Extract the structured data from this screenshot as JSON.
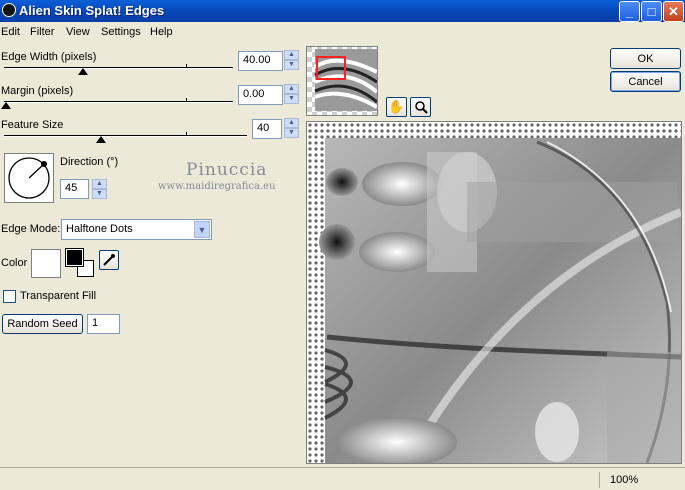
{
  "window": {
    "title": "Alien Skin Splat! Edges"
  },
  "menu": [
    "Edit",
    "Filter",
    "View",
    "Settings",
    "Help"
  ],
  "controls": {
    "edge_width": {
      "label": "Edge Width (pixels)",
      "value": "40.00"
    },
    "margin": {
      "label": "Margin (pixels)",
      "value": "0.00"
    },
    "feature_size": {
      "label": "Feature Size",
      "value": "40"
    },
    "direction": {
      "label": "Direction (°)",
      "value": "45"
    },
    "edge_mode": {
      "label": "Edge Mode:",
      "value": "Halftone Dots"
    },
    "color": {
      "label": "Color"
    },
    "transparent_fill": {
      "label": "Transparent Fill",
      "checked": false
    },
    "random_seed": {
      "button": "Random Seed",
      "value": "1"
    }
  },
  "buttons": {
    "ok": "OK",
    "cancel": "Cancel"
  },
  "watermark": {
    "name": "Pinuccia",
    "site": "www.maidiregrafica.eu"
  },
  "status": {
    "zoom": "100%"
  },
  "colors": {
    "titlebar": "#0a5fd8",
    "face": "#ece9d8",
    "preview_selection": "#ff2020"
  }
}
